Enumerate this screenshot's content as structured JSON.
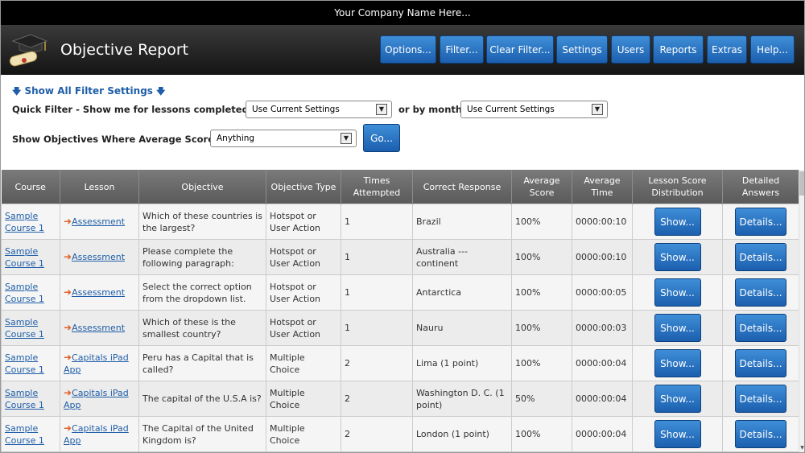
{
  "company_bar": "Your Company Name Here...",
  "header": {
    "title": "Objective Report",
    "nav": [
      "Options...",
      "Filter...",
      "Clear Filter...",
      "Settings",
      "Users",
      "Reports",
      "Extras",
      "Help..."
    ]
  },
  "filters": {
    "show_all": "Show All Filter Settings",
    "quick_label": "Quick Filter - Show me for lessons completed as of:",
    "quick_value": "Use Current Settings",
    "month_label": "or by month:",
    "month_value": "Use Current Settings",
    "avg_label": "Show Objectives Where Average Score is:",
    "avg_value": "Anything",
    "go": "Go..."
  },
  "table": {
    "headers": [
      "Course",
      "Lesson",
      "Objective",
      "Objective Type",
      "Times Attempted",
      "Correct Response",
      "Average Score",
      "Average Time",
      "Lesson Score Distribution",
      "Detailed Answers"
    ],
    "rows": [
      {
        "course": "Sample Course 1",
        "lesson": "Assessment",
        "objective": "Which of these countries is the largest?",
        "type": "Hotspot or User Action",
        "times": "1",
        "correct": "Brazil",
        "avg_score": "100%",
        "avg_time": "0000:00:10",
        "show": "Show...",
        "details": "Details..."
      },
      {
        "course": "Sample Course 1",
        "lesson": "Assessment",
        "objective": "Please complete the following paragraph:",
        "type": "Hotspot or User Action",
        "times": "1",
        "correct": "Australia --- continent",
        "avg_score": "100%",
        "avg_time": "0000:00:10",
        "show": "Show...",
        "details": "Details..."
      },
      {
        "course": "Sample Course 1",
        "lesson": "Assessment",
        "objective": "Select the correct option from the dropdown list.",
        "type": "Hotspot or User Action",
        "times": "1",
        "correct": "Antarctica",
        "avg_score": "100%",
        "avg_time": "0000:00:05",
        "show": "Show...",
        "details": "Details..."
      },
      {
        "course": "Sample Course 1",
        "lesson": "Assessment",
        "objective": "Which of these is the smallest country?",
        "type": "Hotspot or User Action",
        "times": "1",
        "correct": "Nauru",
        "avg_score": "100%",
        "avg_time": "0000:00:03",
        "show": "Show...",
        "details": "Details..."
      },
      {
        "course": "Sample Course 1",
        "lesson": "Capitals iPad App",
        "objective": "Peru has a Capital that is called?",
        "type": "Multiple Choice",
        "times": "2",
        "correct": "Lima (1 point)",
        "avg_score": "100%",
        "avg_time": "0000:00:04",
        "show": "Show...",
        "details": "Details..."
      },
      {
        "course": "Sample Course 1",
        "lesson": "Capitals iPad App",
        "objective": "The capital of the U.S.A is?",
        "type": "Multiple Choice",
        "times": "2",
        "correct": "Washington D. C. (1 point)",
        "avg_score": "50%",
        "avg_time": "0000:00:04",
        "show": "Show...",
        "details": "Details..."
      },
      {
        "course": "Sample Course 1",
        "lesson": "Capitals iPad App",
        "objective": "The Capital of the United Kingdom is?",
        "type": "Multiple Choice",
        "times": "2",
        "correct": "London (1 point)",
        "avg_score": "100%",
        "avg_time": "0000:00:04",
        "show": "Show...",
        "details": "Details..."
      }
    ]
  },
  "colors": {
    "button_blue": "#2a75c6",
    "link_blue": "#1e5ea8",
    "header_gray": "#6a6a6a",
    "lesson_arrow": "#e0612a"
  },
  "icons": {
    "logo": "graduation-cap-diploma-icon",
    "lesson": "arrow-right-icon",
    "show_all": "arrow-down-icon"
  }
}
